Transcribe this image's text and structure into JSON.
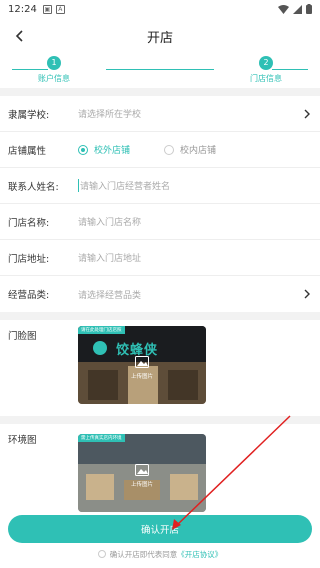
{
  "status": {
    "time": "12:24"
  },
  "nav": {
    "title": "开店"
  },
  "steps": [
    {
      "num": "1",
      "label": "账户信息"
    },
    {
      "num": "2",
      "label": "门店信息"
    }
  ],
  "form": {
    "school": {
      "label": "隶属学校:",
      "placeholder": "请选择所在学校"
    },
    "store_type": {
      "label": "店铺属性",
      "options": [
        "校外店铺",
        "校内店铺"
      ],
      "selected": "校外店铺"
    },
    "contact": {
      "label": "联系人姓名:",
      "placeholder": "请输入门店经营者姓名"
    },
    "store_name": {
      "label": "门店名称:",
      "placeholder": "请输入门店名称"
    },
    "address": {
      "label": "门店地址:",
      "placeholder": "请输入门店地址"
    },
    "category": {
      "label": "经营品类:",
      "placeholder": "请选择经营品类"
    }
  },
  "storefront": {
    "label": "门脸图",
    "tag": "请在此处理门店店照",
    "upload": "上传图片",
    "sign": "饺蜂侠"
  },
  "environment": {
    "label": "环境图",
    "tag": "需上传真实店内环境",
    "upload": "上传图片"
  },
  "confirm": {
    "label": "确认开店"
  },
  "agreement": {
    "prefix": "确认开店即代表同意",
    "link": "《开店协议》"
  },
  "colors": {
    "accent": "#2fc0b5",
    "arrow": "#e02020"
  }
}
